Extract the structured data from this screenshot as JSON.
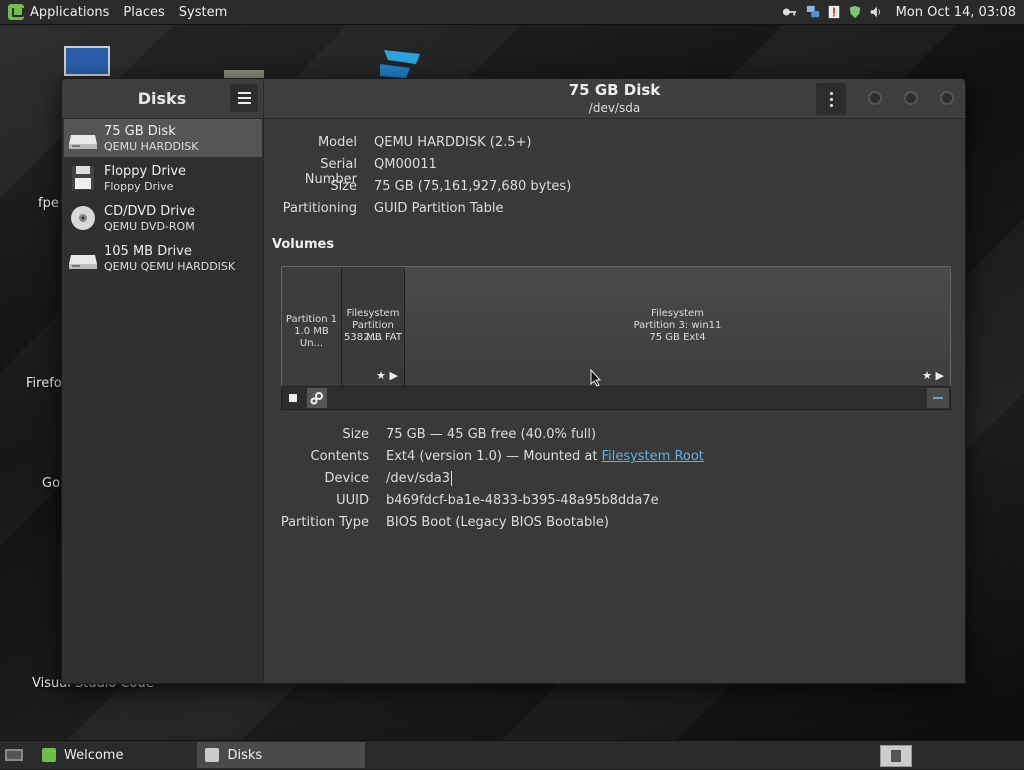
{
  "top_panel": {
    "menu": [
      "Applications",
      "Places",
      "System"
    ],
    "clock": "Mon Oct 14, 03:08"
  },
  "desktop": {
    "labels": [
      "fpe",
      "Firefo",
      "Go",
      "Visual Studio Code"
    ]
  },
  "window": {
    "sidebar_title": "Disks",
    "disk_title": "75 GB Disk",
    "disk_path": "/dev/sda",
    "drives": [
      {
        "name": "75 GB Disk",
        "sub": "QEMU HARDDISK",
        "icon": "harddisk-icon"
      },
      {
        "name": "Floppy Drive",
        "sub": "Floppy Drive",
        "icon": "floppy-icon"
      },
      {
        "name": "CD/DVD Drive",
        "sub": "QEMU DVD-ROM",
        "icon": "optical-disc-icon"
      },
      {
        "name": "105 MB Drive",
        "sub": "QEMU QEMU HARDDISK",
        "icon": "harddisk-icon"
      }
    ],
    "disk_info": [
      {
        "label": "Model",
        "value": "QEMU HARDDISK (2.5+)"
      },
      {
        "label": "Serial Number",
        "value": "QM00011"
      },
      {
        "label": "Size",
        "value": "75 GB (75,161,927,680 bytes)"
      },
      {
        "label": "Partitioning",
        "value": "GUID Partition Table"
      }
    ],
    "volumes_heading": "Volumes",
    "partitions": [
      {
        "line1": "",
        "line2": "Partition 1",
        "line3": "1.0 MB Un..."
      },
      {
        "line1": "Filesystem",
        "line2": "Partition 2:...",
        "line3": "538 MB FAT",
        "marks": "★ ▶"
      },
      {
        "line1": "Filesystem",
        "line2": "Partition 3: win11",
        "line3": "75 GB Ext4",
        "marks": "★ ▶"
      }
    ],
    "volume_info": {
      "size_label": "Size",
      "size": "75 GB — 45 GB free (40.0% full)",
      "contents_label": "Contents",
      "contents_prefix": "Ext4 (version 1.0) — Mounted at ",
      "contents_link": "Filesystem Root",
      "device_label": "Device",
      "device": "/dev/sda3",
      "uuid_label": "UUID",
      "uuid": "b469fdcf-ba1e-4833-b395-48a95b8dda7e",
      "ptype_label": "Partition Type",
      "ptype": "BIOS Boot (Legacy BIOS Bootable)"
    }
  },
  "taskbar": {
    "items": [
      {
        "label": "Welcome",
        "icon": "mint-welcome-icon"
      },
      {
        "label": "Disks",
        "icon": "disks-app-icon"
      }
    ]
  },
  "colors": {
    "selected_bg": "#555555",
    "link": "#5fb0e0",
    "mint_green": "#6fbf4a"
  }
}
